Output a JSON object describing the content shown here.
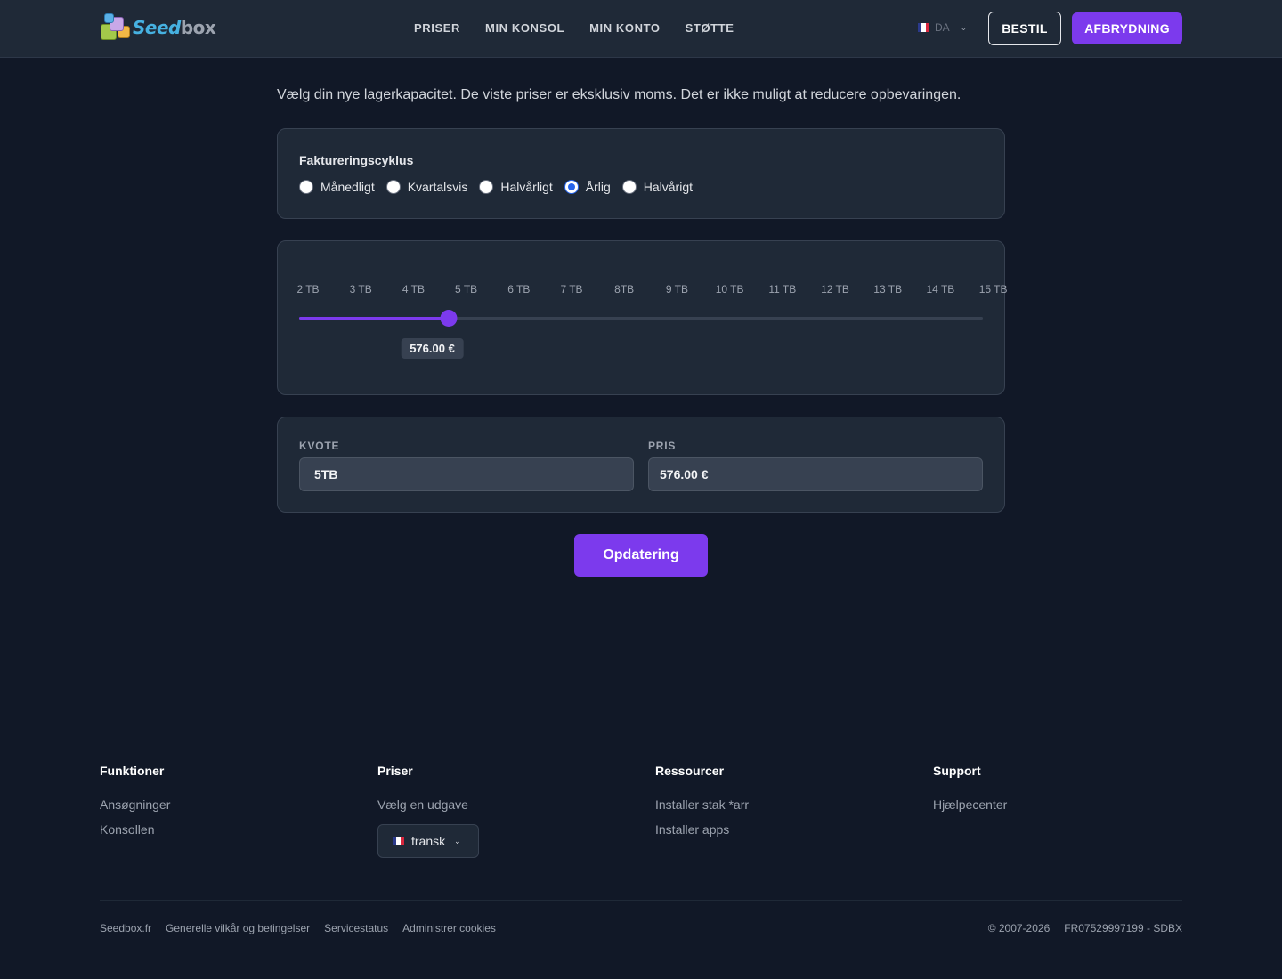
{
  "brand": {
    "logo_part1": "Seed",
    "logo_part2": "box"
  },
  "nav": {
    "items": [
      "PRISER",
      "MIN KONSOL",
      "MIN KONTO",
      "STØTTE"
    ]
  },
  "header": {
    "language_code": "DA",
    "order_button": "BESTIL",
    "cancel_button": "AFBRYDNING"
  },
  "intro": "Vælg din nye lagerkapacitet. De viste priser er eksklusiv moms. Det er ikke muligt at reducere opbevaringen.",
  "billing": {
    "label": "Faktureringscyklus",
    "options": [
      "Månedligt",
      "Kvartalsvis",
      "Halvårligt",
      "Årlig",
      "Halvårigt"
    ],
    "selected_index": 3
  },
  "storage_slider": {
    "ticks": [
      "2 TB",
      "3 TB",
      "4 TB",
      "5 TB",
      "6 TB",
      "7 TB",
      "8TB",
      "9 TB",
      "10 TB",
      "11 TB",
      "12 TB",
      "13 TB",
      "14 TB",
      "15 TB"
    ],
    "selected_tb": 5,
    "min_tb": 2,
    "max_tb": 15,
    "price_bubble": "576.00 €"
  },
  "summary": {
    "quota_label": "KVOTE",
    "quota_value": "5TB",
    "price_label": "PRIS",
    "price_value": "576.00 €"
  },
  "update_button": "Opdatering",
  "footer": {
    "columns": [
      {
        "title": "Funktioner",
        "links": [
          "Ansøgninger",
          "Konsollen"
        ]
      },
      {
        "title": "Priser",
        "links": [
          "Vælg en udgave"
        ],
        "language_select": "fransk"
      },
      {
        "title": "Ressourcer",
        "links": [
          "Installer stak *arr",
          "Installer apps"
        ]
      },
      {
        "title": "Support",
        "links": [
          "Hjælpecenter"
        ]
      }
    ],
    "bottom_links": [
      "Seedbox.fr",
      "Generelle vilkår og betingelser",
      "Servicestatus",
      "Administrer cookies"
    ],
    "copyright": "© 2007-2026",
    "company_id": "FR07529997199 - SDBX"
  },
  "colors": {
    "accent": "#7c3aed",
    "background": "#111827",
    "surface": "#1f2937",
    "radio_selected": "#2563eb"
  },
  "icons": {
    "language_flag": "french-flag-icon",
    "dropdown": "chevron-down-icon"
  }
}
